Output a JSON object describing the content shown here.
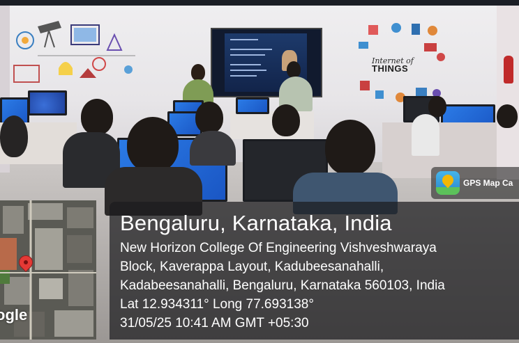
{
  "overlay": {
    "app_name": "GPS Map Ca",
    "app_icon": "gps-map-camera-icon",
    "location_title": "Bengaluru, Karnataka, India",
    "address_lines": [
      "New Horizon College Of Engineering Vishveshwaraya",
      "Block, Kaverappa Layout, Kadubeesanahalli,",
      "Kadabeesanahalli, Bengaluru, Karnataka 560103, India"
    ],
    "coordinates": "Lat 12.934311° Long 77.693138°",
    "datetime": "31/05/25 10:41 AM GMT +05:30",
    "map_label": "ogle"
  },
  "wall_art": {
    "right_mural_text_top": "Internet of",
    "right_mural_text_bottom": "THINGS"
  },
  "colors": {
    "panel": "#1c1c1e",
    "text": "#ffffff",
    "monitor_screen": "#2b7be6",
    "map_marker": "#e53935"
  }
}
